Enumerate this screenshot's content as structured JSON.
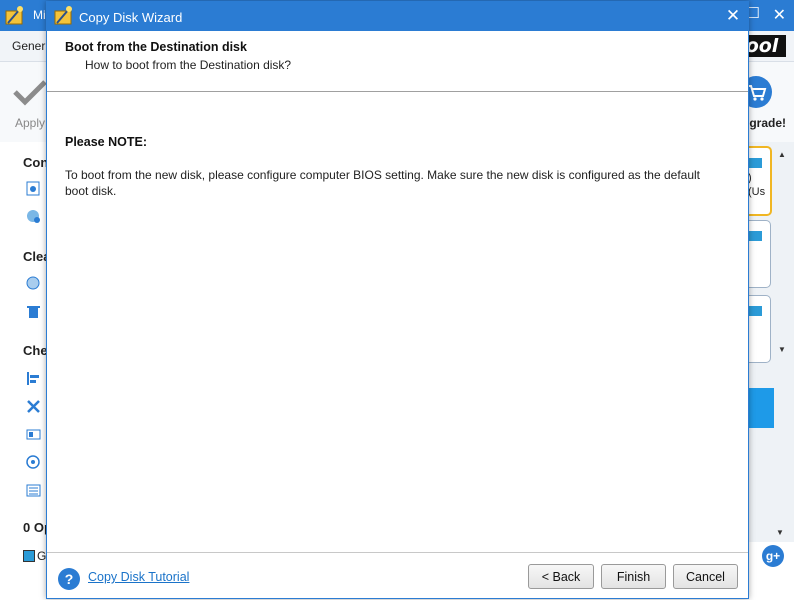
{
  "background_app": {
    "title": "Mi",
    "menu_general": "Gener",
    "logo_text": "ool",
    "apply_label": "Apply",
    "upgrade_label": "grade!",
    "sidebar_sections": [
      "Con",
      "Clea",
      "Che"
    ],
    "disk1_line1": ")",
    "disk1_line2": "(Us",
    "operations_label": "0 Op",
    "legend_label": "G",
    "social_label": "g+"
  },
  "dialog": {
    "title": "Copy Disk Wizard",
    "heading": "Boot from the Destination disk",
    "subheading": "How to boot from the Destination disk?",
    "note_title": "Please NOTE:",
    "note_text": "To boot from the new disk, please configure computer BIOS setting. Make sure the new disk is configured as the default boot disk.",
    "help_link": "Copy Disk Tutorial",
    "buttons": {
      "back": "< Back",
      "finish": "Finish",
      "cancel": "Cancel"
    }
  },
  "colors": {
    "titlebar": "#2b7cd3",
    "link": "#1a73c9",
    "accent_disk": "#2b9bd7",
    "selected_border": "#f0b623"
  },
  "icons": [
    "wizard-icon",
    "close-icon",
    "maximize-icon",
    "help-icon",
    "cart-icon",
    "checkmark-icon"
  ]
}
